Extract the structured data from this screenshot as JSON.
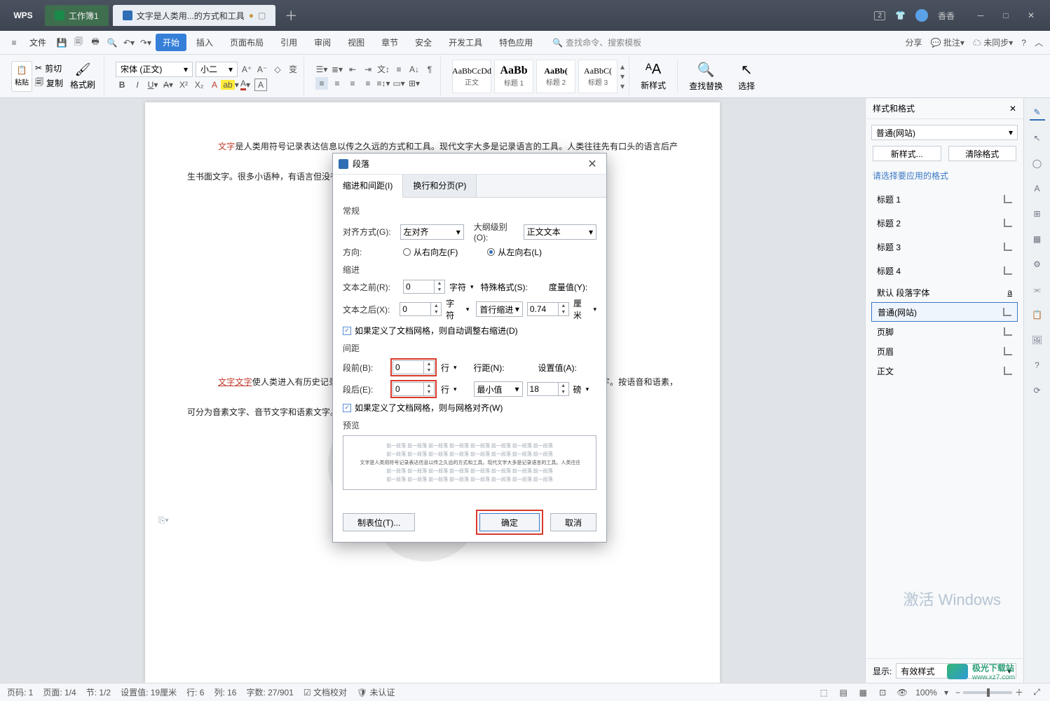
{
  "titlebar": {
    "wps": "WPS",
    "tab1": "工作簿1",
    "tab2": "文字是人类用...的方式和工具",
    "badge": "2",
    "user": "香香"
  },
  "ribbon": {
    "file": "文件",
    "tabs": [
      "开始",
      "插入",
      "页面布局",
      "引用",
      "审阅",
      "视图",
      "章节",
      "安全",
      "开发工具",
      "特色应用"
    ],
    "search": "查找命令、搜索模板",
    "share": "分享",
    "annot": "批注",
    "sync": "未同步"
  },
  "tb": {
    "paste": "粘贴",
    "cut": "剪切",
    "copy": "复制",
    "fmtpaint": "格式刷",
    "font": "宋体 (正文)",
    "size": "小二",
    "styles": [
      {
        "p": "AaBbCcDd",
        "l": "正文"
      },
      {
        "p": "AaBb",
        "l": "标题 1"
      },
      {
        "p": "AaBb(",
        "l": "标题 2"
      },
      {
        "p": "AaBbC(",
        "l": "标题 3"
      }
    ],
    "newstyle": "新样式",
    "findrep": "查找替换",
    "select": "选择"
  },
  "doc": {
    "p1a": "文字",
    "p1b": "是人类用符号记录表达信息以传之久远的方式和工具。现代文字大多是记录语言的工具。人类往往先有口头的语言后产生书面文字。很多小语种，有语言但没有文字。文字的不同体现了国家和民族的书面表达的方式和思维不同。",
    "p2a": "文字",
    "p2b": "文字",
    "p2c": "使人类进入有历史记录的文明社会。文字按字音和字形，可分为表形文字、表音文字和意音文字。按语音和语素，可分为音素文字、音节文字和语素文字。 表形文字是人类早期原生文字的象形文字，"
  },
  "sidepanel": {
    "title": "样式和格式",
    "combo": "普通(网站)",
    "new": "新样式...",
    "clear": "清除格式",
    "hint": "请选择要应用的格式",
    "items": [
      "标题 1",
      "标题 2",
      "标题 3",
      "标题 4"
    ],
    "def": "默认 段落字体",
    "sel": "普通(网站)",
    "ftr": "页脚",
    "hdr": "页眉",
    "body": "正文",
    "show_l": "显示:",
    "show_v": "有效样式"
  },
  "status": {
    "page": "页码: 1",
    "pages": "页面: 1/4",
    "sect": "节: 1/2",
    "set": "设置值: 19厘米",
    "row": "行: 6",
    "col": "列: 16",
    "words": "字数: 27/901",
    "proof": "文档校对",
    "unauth": "未认证",
    "zoom": "100%"
  },
  "dlg": {
    "title": "段落",
    "tab1": "缩进和间距(I)",
    "tab2": "换行和分页(P)",
    "s1": "常规",
    "align_l": "对齐方式(G):",
    "align_v": "左对齐",
    "outline_l": "大纲级别(O):",
    "outline_v": "正文文本",
    "dir_l": "方向:",
    "dir_rtl": "从右向左(F)",
    "dir_ltr": "从左向右(L)",
    "s2": "缩进",
    "before_txt_l": "文本之前(R):",
    "after_txt_l": "文本之后(X):",
    "char": "字符",
    "special_l": "特殊格式(S):",
    "special_v": "首行缩进",
    "measure_l": "度量值(Y):",
    "measure_v": "0.74",
    "cm": "厘米",
    "grid1": "如果定义了文档网格，则自动调整右缩进(D)",
    "s3": "间距",
    "sp_before_l": "段前(B):",
    "sp_after_l": "段后(E):",
    "line": "行",
    "linesp_l": "行距(N):",
    "linesp_v": "最小值",
    "setval_l": "设置值(A):",
    "setval_v": "18",
    "pt": "磅",
    "grid2": "如果定义了文档网格，则与网格对齐(W)",
    "s4": "预览",
    "prev_line": "前一段落  前一段落  前一段落  前一段落  前一段落  前一段落  前一段落  前一段落",
    "prev_body": "文字是人类用符号记录表达信息以传之久远的方式和工具。现代文字大多是记录语言的工具。人类往往先有口头的语言后产生书面文字。很多小语种，有语言但没有文字。文字……",
    "tabstops": "制表位(T)...",
    "ok": "确定",
    "cancel": "取消",
    "v0": "0"
  },
  "activate": "激活 Windows",
  "brand": {
    "name": "极光下载站",
    "url": "www.xz7.com"
  }
}
